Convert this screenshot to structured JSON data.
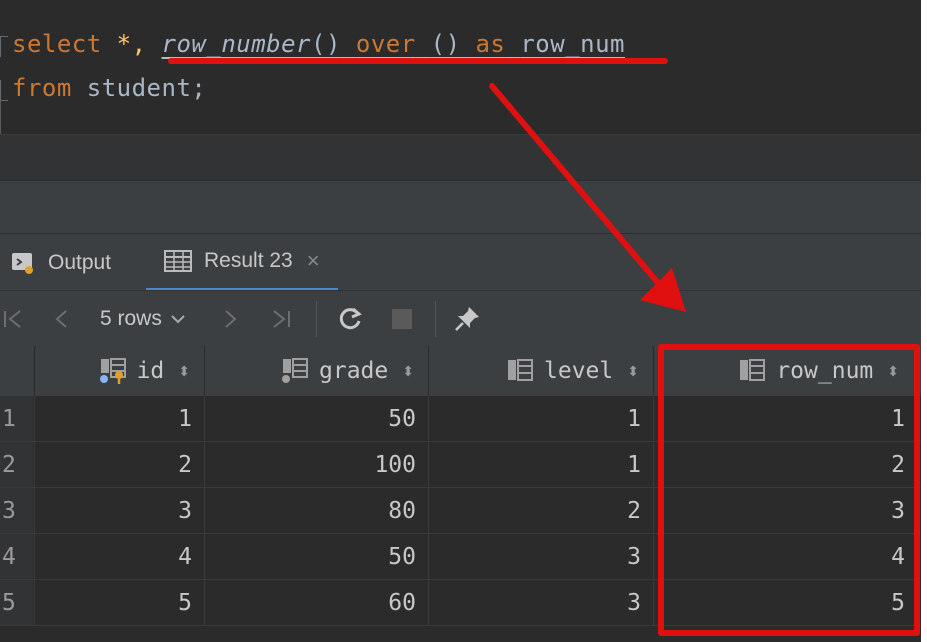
{
  "editor": {
    "line1": {
      "select": "select",
      "star": "*,",
      "fn": "row_number",
      "paren1": "()",
      "over": "over",
      "paren2": "()",
      "as": "as",
      "alias": "row_num"
    },
    "line2": {
      "from": "from",
      "table": "student;"
    }
  },
  "tabs": [
    {
      "label": "Output",
      "icon": "output-console-icon"
    },
    {
      "label": "Result 23",
      "icon": "table-grid-icon",
      "active": true
    }
  ],
  "tab_close": "×",
  "toolbar": {
    "rows_label": "5 rows",
    "icons": [
      "first-page-icon",
      "prev-page-icon",
      "rows-dropdown-chevron-icon",
      "next-page-icon",
      "last-page-icon",
      "refresh-icon",
      "stop-icon",
      "pin-icon"
    ]
  },
  "table": {
    "columns": [
      {
        "name": "id",
        "icon": "primary-key-column-icon"
      },
      {
        "name": "grade",
        "icon": "index-column-icon"
      },
      {
        "name": "level",
        "icon": "column-icon"
      },
      {
        "name": "row_num",
        "icon": "column-icon"
      }
    ],
    "sort_glyph": "⬍",
    "rows": [
      {
        "n": "1",
        "id": "1",
        "grade": "50",
        "level": "1",
        "row_num": "1"
      },
      {
        "n": "2",
        "id": "2",
        "grade": "100",
        "level": "1",
        "row_num": "2"
      },
      {
        "n": "3",
        "id": "3",
        "grade": "80",
        "level": "2",
        "row_num": "3"
      },
      {
        "n": "4",
        "id": "4",
        "grade": "50",
        "level": "3",
        "row_num": "4"
      },
      {
        "n": "5",
        "id": "5",
        "grade": "60",
        "level": "3",
        "row_num": "5"
      }
    ]
  },
  "colors": {
    "keyword": "#cc7832",
    "identifier": "#a9b7c6",
    "annotation_red": "#e01010",
    "active_tab_underline": "#4a88c7"
  }
}
